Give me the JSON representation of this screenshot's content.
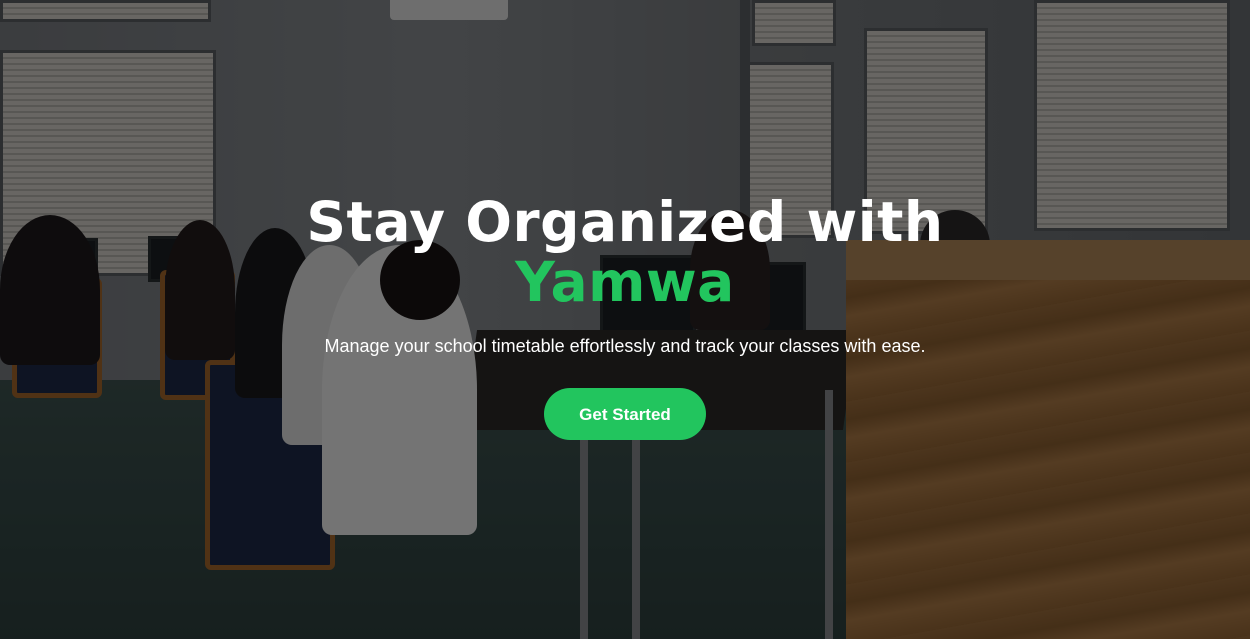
{
  "hero": {
    "headline_line1": "Stay Organized with",
    "headline_brand": "Yamwa",
    "subtitle": "Manage your school timetable effortlessly and track your classes with ease.",
    "cta_label": "Get Started"
  },
  "colors": {
    "brand_green": "#22c55e",
    "text": "#ffffff",
    "overlay": "rgba(0,0,0,0.52)"
  }
}
